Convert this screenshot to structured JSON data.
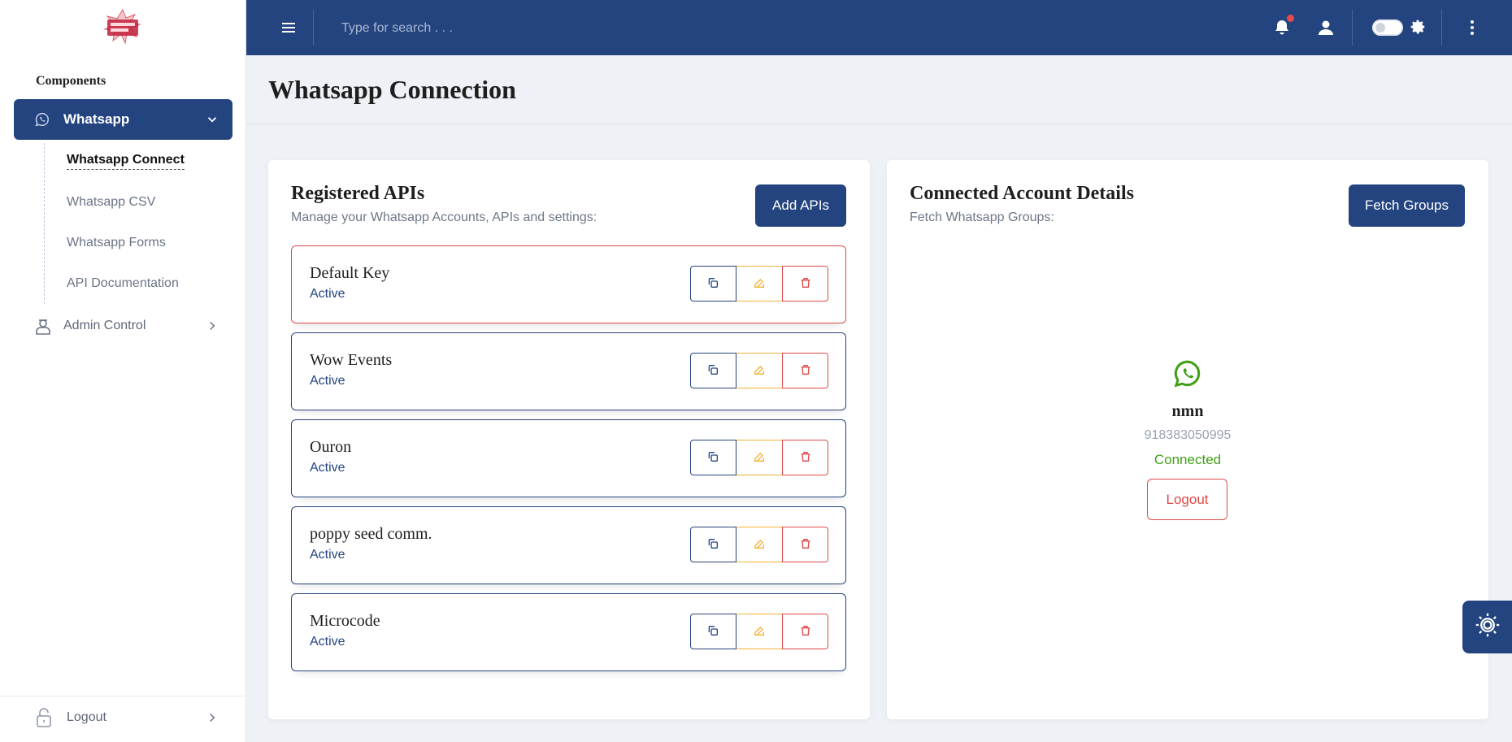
{
  "sidebar": {
    "section_label": "Components",
    "active_nav": {
      "label": "Whatsapp",
      "icon": "whatsapp-icon"
    },
    "sub_items": [
      {
        "label": "Whatsapp Connect",
        "active": true
      },
      {
        "label": "Whatsapp CSV",
        "active": false
      },
      {
        "label": "Whatsapp Forms",
        "active": false
      },
      {
        "label": "API Documentation",
        "active": false
      }
    ],
    "admin": {
      "label": "Admin Control",
      "icon": "admin-icon"
    },
    "logout": {
      "label": "Logout",
      "icon": "lock-icon"
    }
  },
  "topbar": {
    "search_placeholder": "Type for search . . .",
    "notification_badge": true
  },
  "page": {
    "title": "Whatsapp Connection"
  },
  "registered_apis": {
    "title": "Registered APIs",
    "subtitle": "Manage your Whatsapp Accounts, APIs and settings:",
    "add_button": "Add APIs",
    "items": [
      {
        "name": "Default Key",
        "status": "Active"
      },
      {
        "name": "Wow Events",
        "status": "Active"
      },
      {
        "name": "Ouron",
        "status": "Active"
      },
      {
        "name": "poppy seed comm.",
        "status": "Active"
      },
      {
        "name": "Microcode",
        "status": "Active"
      }
    ]
  },
  "connected_account": {
    "title": "Connected Account Details",
    "subtitle": "Fetch Whatsapp Groups:",
    "fetch_button": "Fetch Groups",
    "name": "nmn",
    "phone": "918383050995",
    "status": "Connected",
    "logout_button": "Logout"
  },
  "colors": {
    "primary": "#244480",
    "danger": "#e04848",
    "warning": "#f2b234",
    "success": "#41a016",
    "background": "#eef1f6"
  }
}
